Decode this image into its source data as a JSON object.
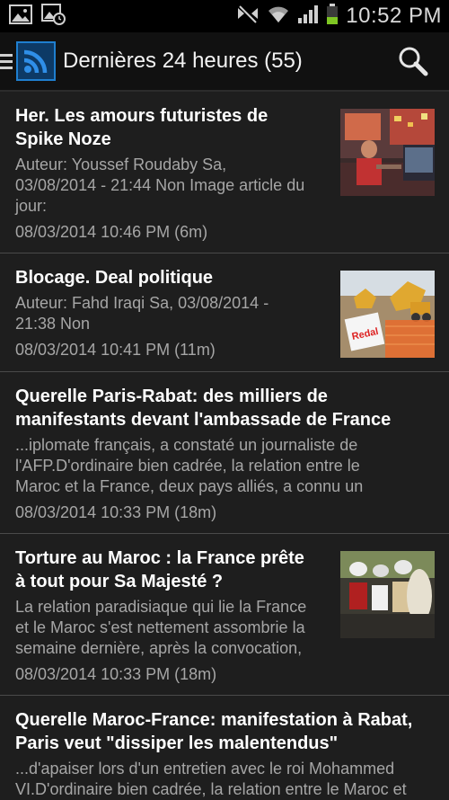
{
  "status_bar": {
    "time": "10:52 PM",
    "left_icons": [
      "image-icon",
      "alarm-image-icon"
    ],
    "right_icons": [
      "no-notifications-icon",
      "wifi-icon",
      "signal-icon",
      "battery-icon"
    ]
  },
  "action_bar": {
    "title": "Dernières 24 heures (55)",
    "menu_icon": "hamburger-icon",
    "app_icon": "rss-icon",
    "search_icon": "search-icon"
  },
  "articles": [
    {
      "title_line1": "Her. Les amours futuristes de",
      "title_line2": "Spike Noze",
      "snippet_line1": "Auteur:  Youssef Roudaby Sa,",
      "snippet_line2": "03/08/2014 - 21:44 Non Image article du",
      "snippet_line3": "jour:",
      "date": "08/03/2014 10:46 PM (6m)",
      "has_thumbnail": true
    },
    {
      "title_line1": "Blocage. Deal politique",
      "snippet_line1": "Auteur:  Fahd Iraqi Sa, 03/08/2014 -",
      "snippet_line2": "21:38 Non",
      "date": "08/03/2014 10:41 PM (11m)",
      "has_thumbnail": true
    },
    {
      "title_line1": "Querelle Paris-Rabat: des milliers de",
      "title_line2": "manifestants devant l'ambassade de France",
      "snippet_line1": "...iplomate français, a constaté un journaliste de",
      "snippet_line2": "l'AFP.D'ordinaire bien cadrée, la relation entre le",
      "snippet_line3": "Maroc et la France, deux pays alliés, a connu un",
      "date": "08/03/2014 10:33 PM (18m)",
      "has_thumbnail": false
    },
    {
      "title_line1": "Torture au Maroc : la France prête",
      "title_line2": "à tout pour Sa Majesté ?",
      "snippet_line1": "La relation paradisiaque qui lie la France",
      "snippet_line2": "et le Maroc s'est nettement assombrie la",
      "snippet_line3": "semaine dernière, après la convocation,",
      "date": "08/03/2014 10:33 PM (18m)",
      "has_thumbnail": true
    },
    {
      "title_line1": "Querelle Maroc-France: manifestation à Rabat,",
      "title_line2": "Paris veut \"dissiper les malentendus\"",
      "snippet_line1": "...d'apaiser lors d'un entretien avec le roi Mohammed",
      "snippet_line2": "VI.D'ordinaire bien cadrée, la relation entre le Maroc et",
      "has_thumbnail": false
    }
  ],
  "thumbnail_2_caption": "Redal"
}
